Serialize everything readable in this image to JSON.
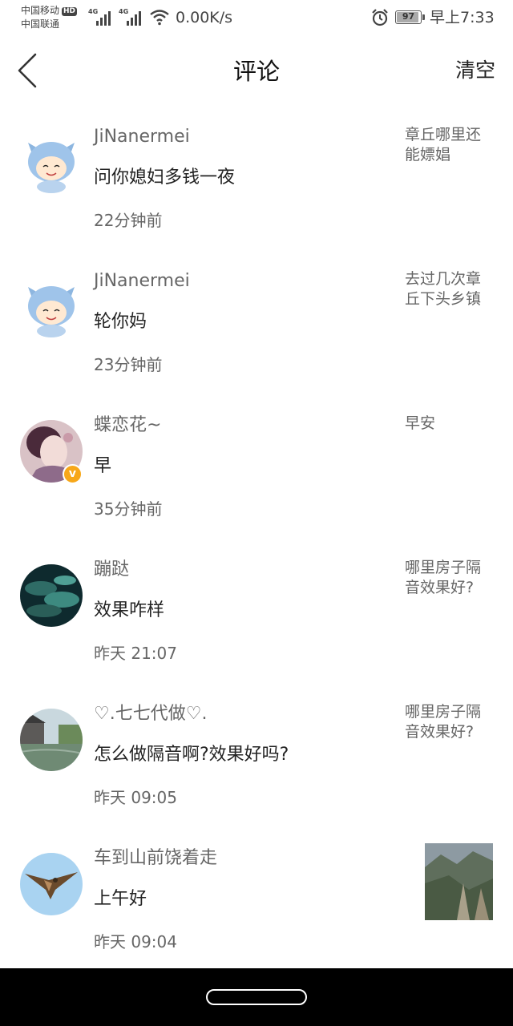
{
  "status_bar": {
    "carrier_1": "中国移动",
    "hd_badge": "HD",
    "carrier_2": "中国联通",
    "net_1": "4G",
    "net_2": "4G",
    "speed": "0.00K/s",
    "battery": "97",
    "time": "早上7:33"
  },
  "header": {
    "title": "评论",
    "clear_label": "清空"
  },
  "comments": [
    {
      "user": "JiNanermei",
      "text": "问你媳妇多钱一夜",
      "time": "22分钟前",
      "quote": "章丘哪里还能嫖娼"
    },
    {
      "user": "JiNanermei",
      "text": "轮你妈",
      "time": "23分钟前",
      "quote": "去过几次章丘下头乡镇"
    },
    {
      "user": "蝶恋花~",
      "text": "早",
      "time": "35分钟前",
      "quote": "早安",
      "badge": "v"
    },
    {
      "user": "蹦跶",
      "text": "效果咋样",
      "time": "昨天 21:07",
      "quote": "哪里房子隔音效果好?"
    },
    {
      "user": "♡.七七代做♡.",
      "text": "怎么做隔音啊?效果好吗?",
      "time": "昨天 09:05",
      "quote": "哪里房子隔音效果好?"
    },
    {
      "user": "车到山前饶着走",
      "text": "上午好",
      "time": "昨天 09:04"
    }
  ],
  "icons": {
    "back": "chevron-left-icon",
    "alarm": "alarm-clock-icon",
    "wifi": "wifi-icon"
  },
  "colors": {
    "background": "#ffffff",
    "secondary_text": "#666666",
    "verified_badge": "#f7a719",
    "nav_bar": "#000000"
  }
}
